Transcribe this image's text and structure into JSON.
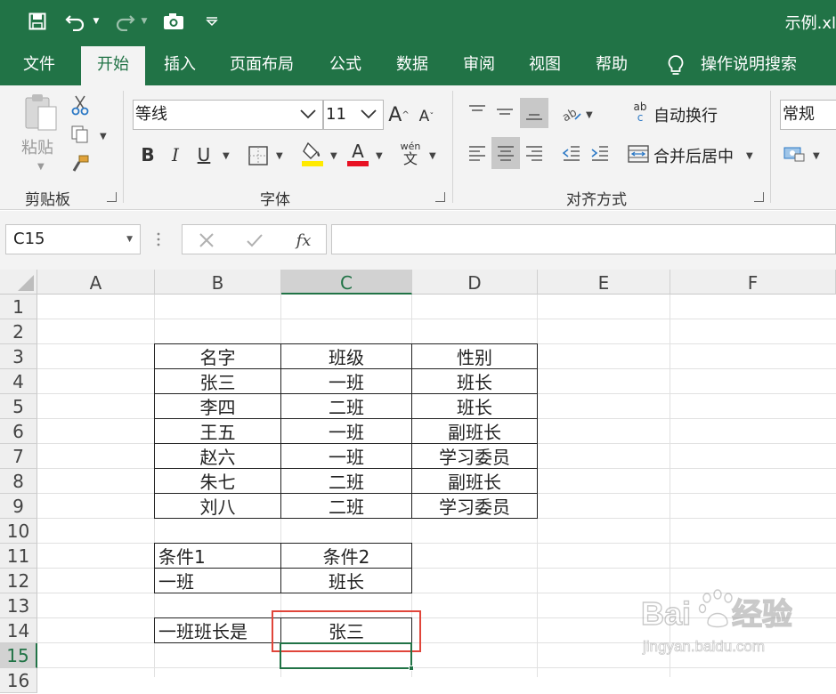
{
  "window": {
    "title": "示例.xl"
  },
  "tabs": [
    "文件",
    "开始",
    "插入",
    "页面布局",
    "公式",
    "数据",
    "审阅",
    "视图",
    "帮助"
  ],
  "tell_me": "操作说明搜索",
  "ribbon": {
    "paste_label": "粘贴",
    "clipboard_label": "剪贴板",
    "font_group_label": "字体",
    "font_name": "等线",
    "font_size": "11",
    "bold": "B",
    "italic": "I",
    "underline": "U",
    "wen": "wén",
    "wen_char": "文",
    "grow_font": "A",
    "shrink_font": "A",
    "font_color_letter": "A",
    "align_group_label": "对齐方式",
    "wrap_text": "自动换行",
    "merge_center": "合并后居中",
    "number_format": "常规",
    "ab_icon": "ab",
    "c_icon": "c",
    "font_color": "#e81123",
    "highlight_color": "#ffea00"
  },
  "formula_bar": {
    "name_box": "C15",
    "fx": "fx",
    "formula": ""
  },
  "columns": [
    "A",
    "B",
    "C",
    "D",
    "E",
    "F"
  ],
  "rows": [
    "1",
    "2",
    "3",
    "4",
    "5",
    "6",
    "7",
    "8",
    "9",
    "10",
    "11",
    "12",
    "13",
    "14",
    "15",
    "16"
  ],
  "cells": {
    "B3": "名字",
    "C3": "班级",
    "D3": "性别",
    "B4": "张三",
    "C4": "一班",
    "D4": "班长",
    "B5": "李四",
    "C5": "二班",
    "D5": "班长",
    "B6": "王五",
    "C6": "一班",
    "D6": "副班长",
    "B7": "赵六",
    "C7": "一班",
    "D7": "学习委员",
    "B8": "朱七",
    "C8": "二班",
    "D8": "副班长",
    "B9": "刘八",
    "C9": "二班",
    "D9": "学习委员",
    "B11": "条件1",
    "C11": "条件2",
    "B12": "一班",
    "C12": "班长",
    "B14": "一班班长是",
    "C14": "张三"
  },
  "selected_cell": "C15",
  "watermark": {
    "text": "Baidu经验",
    "url": "jingyan.baidu.com"
  },
  "colors": {
    "accent": "#217346",
    "highlight_box": "#e0453a"
  }
}
